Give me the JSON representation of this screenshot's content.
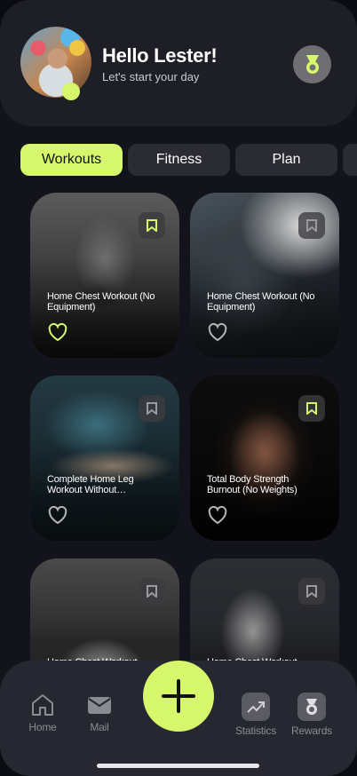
{
  "header": {
    "greeting": "Hello Lester!",
    "subtitle": "Let's start your day",
    "avatar_icon": "user-photo",
    "medal_icon": "medal-icon"
  },
  "tabs": [
    {
      "label": "Workouts",
      "active": true
    },
    {
      "label": "Fitness",
      "active": false
    },
    {
      "label": "Plan",
      "active": false
    },
    {
      "label": "",
      "active": false
    }
  ],
  "cards": [
    {
      "title": "Home Chest Workout (No Equipment)",
      "bookmarked": true,
      "liked": true
    },
    {
      "title": "Home Chest Workout (No Equipment)",
      "bookmarked": false,
      "liked": false
    },
    {
      "title": "Complete Home Leg Workout Without…",
      "bookmarked": false,
      "liked": false
    },
    {
      "title": "Total Body Strength Burnout (No Weights)",
      "bookmarked": true,
      "liked": false
    },
    {
      "title": "Home Chest Workout",
      "bookmarked": false,
      "liked": false
    },
    {
      "title": "Home Chest Workout",
      "bookmarked": false,
      "liked": false
    }
  ],
  "nav": {
    "home": "Home",
    "mail": "Mail",
    "statistics": "Statistics",
    "rewards": "Rewards"
  },
  "colors": {
    "accent": "#d6f66b",
    "background": "#12131b",
    "surface": "#1d1e26",
    "tab_inactive": "#2a2b33",
    "nav_label": "#8a8b93"
  }
}
